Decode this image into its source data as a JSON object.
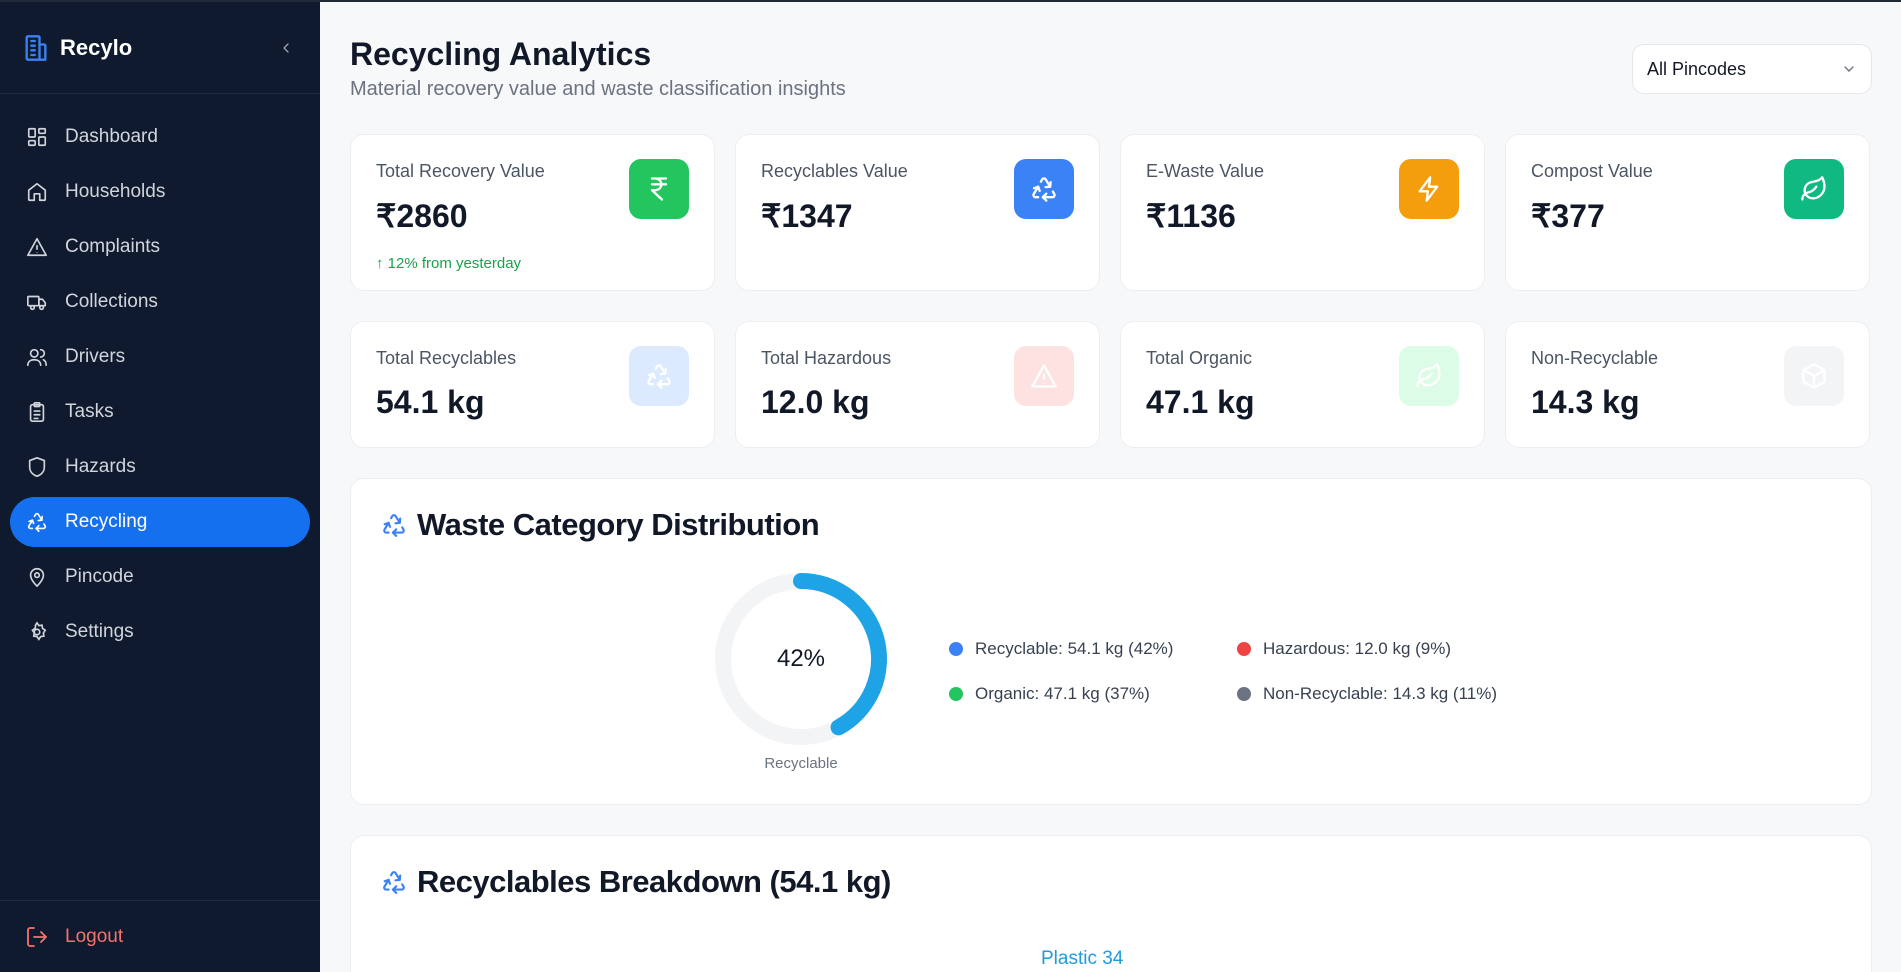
{
  "app": {
    "name": "Recylo"
  },
  "sidebar": {
    "items": [
      {
        "label": "Dashboard",
        "icon": "grid-icon"
      },
      {
        "label": "Households",
        "icon": "home-icon"
      },
      {
        "label": "Complaints",
        "icon": "warning-icon"
      },
      {
        "label": "Collections",
        "icon": "truck-icon"
      },
      {
        "label": "Drivers",
        "icon": "users-icon"
      },
      {
        "label": "Tasks",
        "icon": "clipboard-icon"
      },
      {
        "label": "Hazards",
        "icon": "shield-icon"
      },
      {
        "label": "Recycling",
        "icon": "recycle-icon",
        "active": true
      },
      {
        "label": "Pincode",
        "icon": "map-pin-icon"
      },
      {
        "label": "Settings",
        "icon": "gear-icon"
      }
    ],
    "logout_label": "Logout"
  },
  "header": {
    "title": "Recycling Analytics",
    "subtitle": "Material recovery value and waste classification insights",
    "filter": {
      "selected": "All Pincodes"
    }
  },
  "value_cards": [
    {
      "label": "Total Recovery Value",
      "value": "₹2860",
      "trend": "↑ 12% from yesterday",
      "icon": "rupee-icon",
      "color": "#22c55e"
    },
    {
      "label": "Recyclables Value",
      "value": "₹1347",
      "icon": "recycle-icon",
      "color": "#3b82f6"
    },
    {
      "label": "E-Waste Value",
      "value": "₹1136",
      "icon": "lightning-icon",
      "color": "#f59e0b"
    },
    {
      "label": "Compost Value",
      "value": "₹377",
      "icon": "leaf-icon",
      "color": "#10b981"
    }
  ],
  "weight_cards": [
    {
      "label": "Total Recyclables",
      "value": "54.1 kg",
      "icon": "recycle-icon",
      "color": "#dbeafe"
    },
    {
      "label": "Total Hazardous",
      "value": "12.0 kg",
      "icon": "warning-icon",
      "color": "#fee2e2"
    },
    {
      "label": "Total Organic",
      "value": "47.1 kg",
      "icon": "leaf-icon",
      "color": "#dcfce7"
    },
    {
      "label": "Non-Recyclable",
      "value": "14.3 kg",
      "icon": "box-icon",
      "color": "#f3f4f6"
    }
  ],
  "distribution": {
    "title": "Waste Category Distribution",
    "center_text": "42%",
    "caption": "Recyclable",
    "legend": [
      {
        "label": "Recyclable: 54.1 kg (42%)",
        "color": "#3b82f6"
      },
      {
        "label": "Hazardous: 12.0 kg (9%)",
        "color": "#ef4444"
      },
      {
        "label": "Organic: 47.1 kg (37%)",
        "color": "#22c55e"
      },
      {
        "label": "Non-Recyclable: 14.3 kg (11%)",
        "color": "#6b7280"
      }
    ]
  },
  "chart_data": {
    "type": "pie",
    "title": "",
    "categories": [
      "Recyclable"
    ],
    "values": [
      42
    ],
    "unit": "%",
    "colors": [
      "#1ea3e6",
      "#f3f4f6"
    ]
  },
  "breakdown": {
    "title": "Recyclables Breakdown (54.1 kg)",
    "first_label": "Plastic 34"
  }
}
